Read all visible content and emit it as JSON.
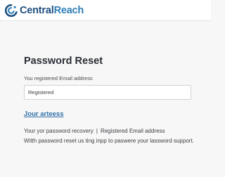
{
  "header": {
    "logo_icon": "centralreach-logo-icon",
    "brand_part1": "Central",
    "brand_part2": "Reach",
    "brand_color_dark": "#1f4f7f",
    "brand_color_light": "#2f7fb6"
  },
  "form": {
    "title": "Password Reset",
    "email_label": "You registered Email address",
    "email_value": "Registered",
    "link_text": "Jour arteess",
    "link_color": "#2e6fa6",
    "recovery_text": "Your yor password recovery",
    "separator": "|",
    "registered_text": "Registered Email address",
    "description": "Witth password reset us ting inpp to paswere your lassword support."
  }
}
